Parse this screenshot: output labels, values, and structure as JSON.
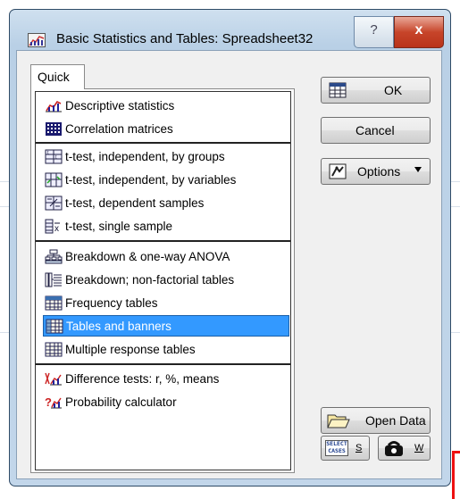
{
  "window": {
    "title": "Basic Statistics and Tables: Spreadsheet32",
    "help_label": "?",
    "close_label": "x"
  },
  "tabs": [
    {
      "label": "Quick"
    }
  ],
  "list": {
    "items": [
      {
        "label": "Descriptive statistics",
        "icon": "descriptive-stats-icon"
      },
      {
        "label": "Correlation matrices",
        "icon": "correlation-matrix-icon"
      },
      {
        "label": "t-test, independent, by groups",
        "icon": "ttest-groups-icon"
      },
      {
        "label": "t-test, independent, by variables",
        "icon": "ttest-variables-icon"
      },
      {
        "label": "t-test, dependent samples",
        "icon": "ttest-dependent-icon"
      },
      {
        "label": "t-test, single sample",
        "icon": "ttest-single-icon"
      },
      {
        "label": "Breakdown & one-way ANOVA",
        "icon": "breakdown-anova-icon"
      },
      {
        "label": "Breakdown; non-factorial tables",
        "icon": "breakdown-nonfactorial-icon"
      },
      {
        "label": "Frequency tables",
        "icon": "frequency-table-icon"
      },
      {
        "label": "Tables and banners",
        "icon": "tables-banners-icon",
        "selected": true
      },
      {
        "label": "Multiple response tables",
        "icon": "multiple-response-icon"
      },
      {
        "label": "Difference tests: r, %, means",
        "icon": "difference-tests-icon"
      },
      {
        "label": "Probability calculator",
        "icon": "probability-calculator-icon"
      }
    ]
  },
  "buttons": {
    "ok": "OK",
    "cancel": "Cancel",
    "options": "Options",
    "open_data": "Open Data",
    "select_cases_line1": "SELECT",
    "select_cases_line2": "CASES",
    "select_cases_key": "S",
    "weight_key": "W"
  },
  "colors": {
    "selection": "#3399ff",
    "title_bar": "#c2d6ea",
    "close_button": "#c7452a"
  }
}
